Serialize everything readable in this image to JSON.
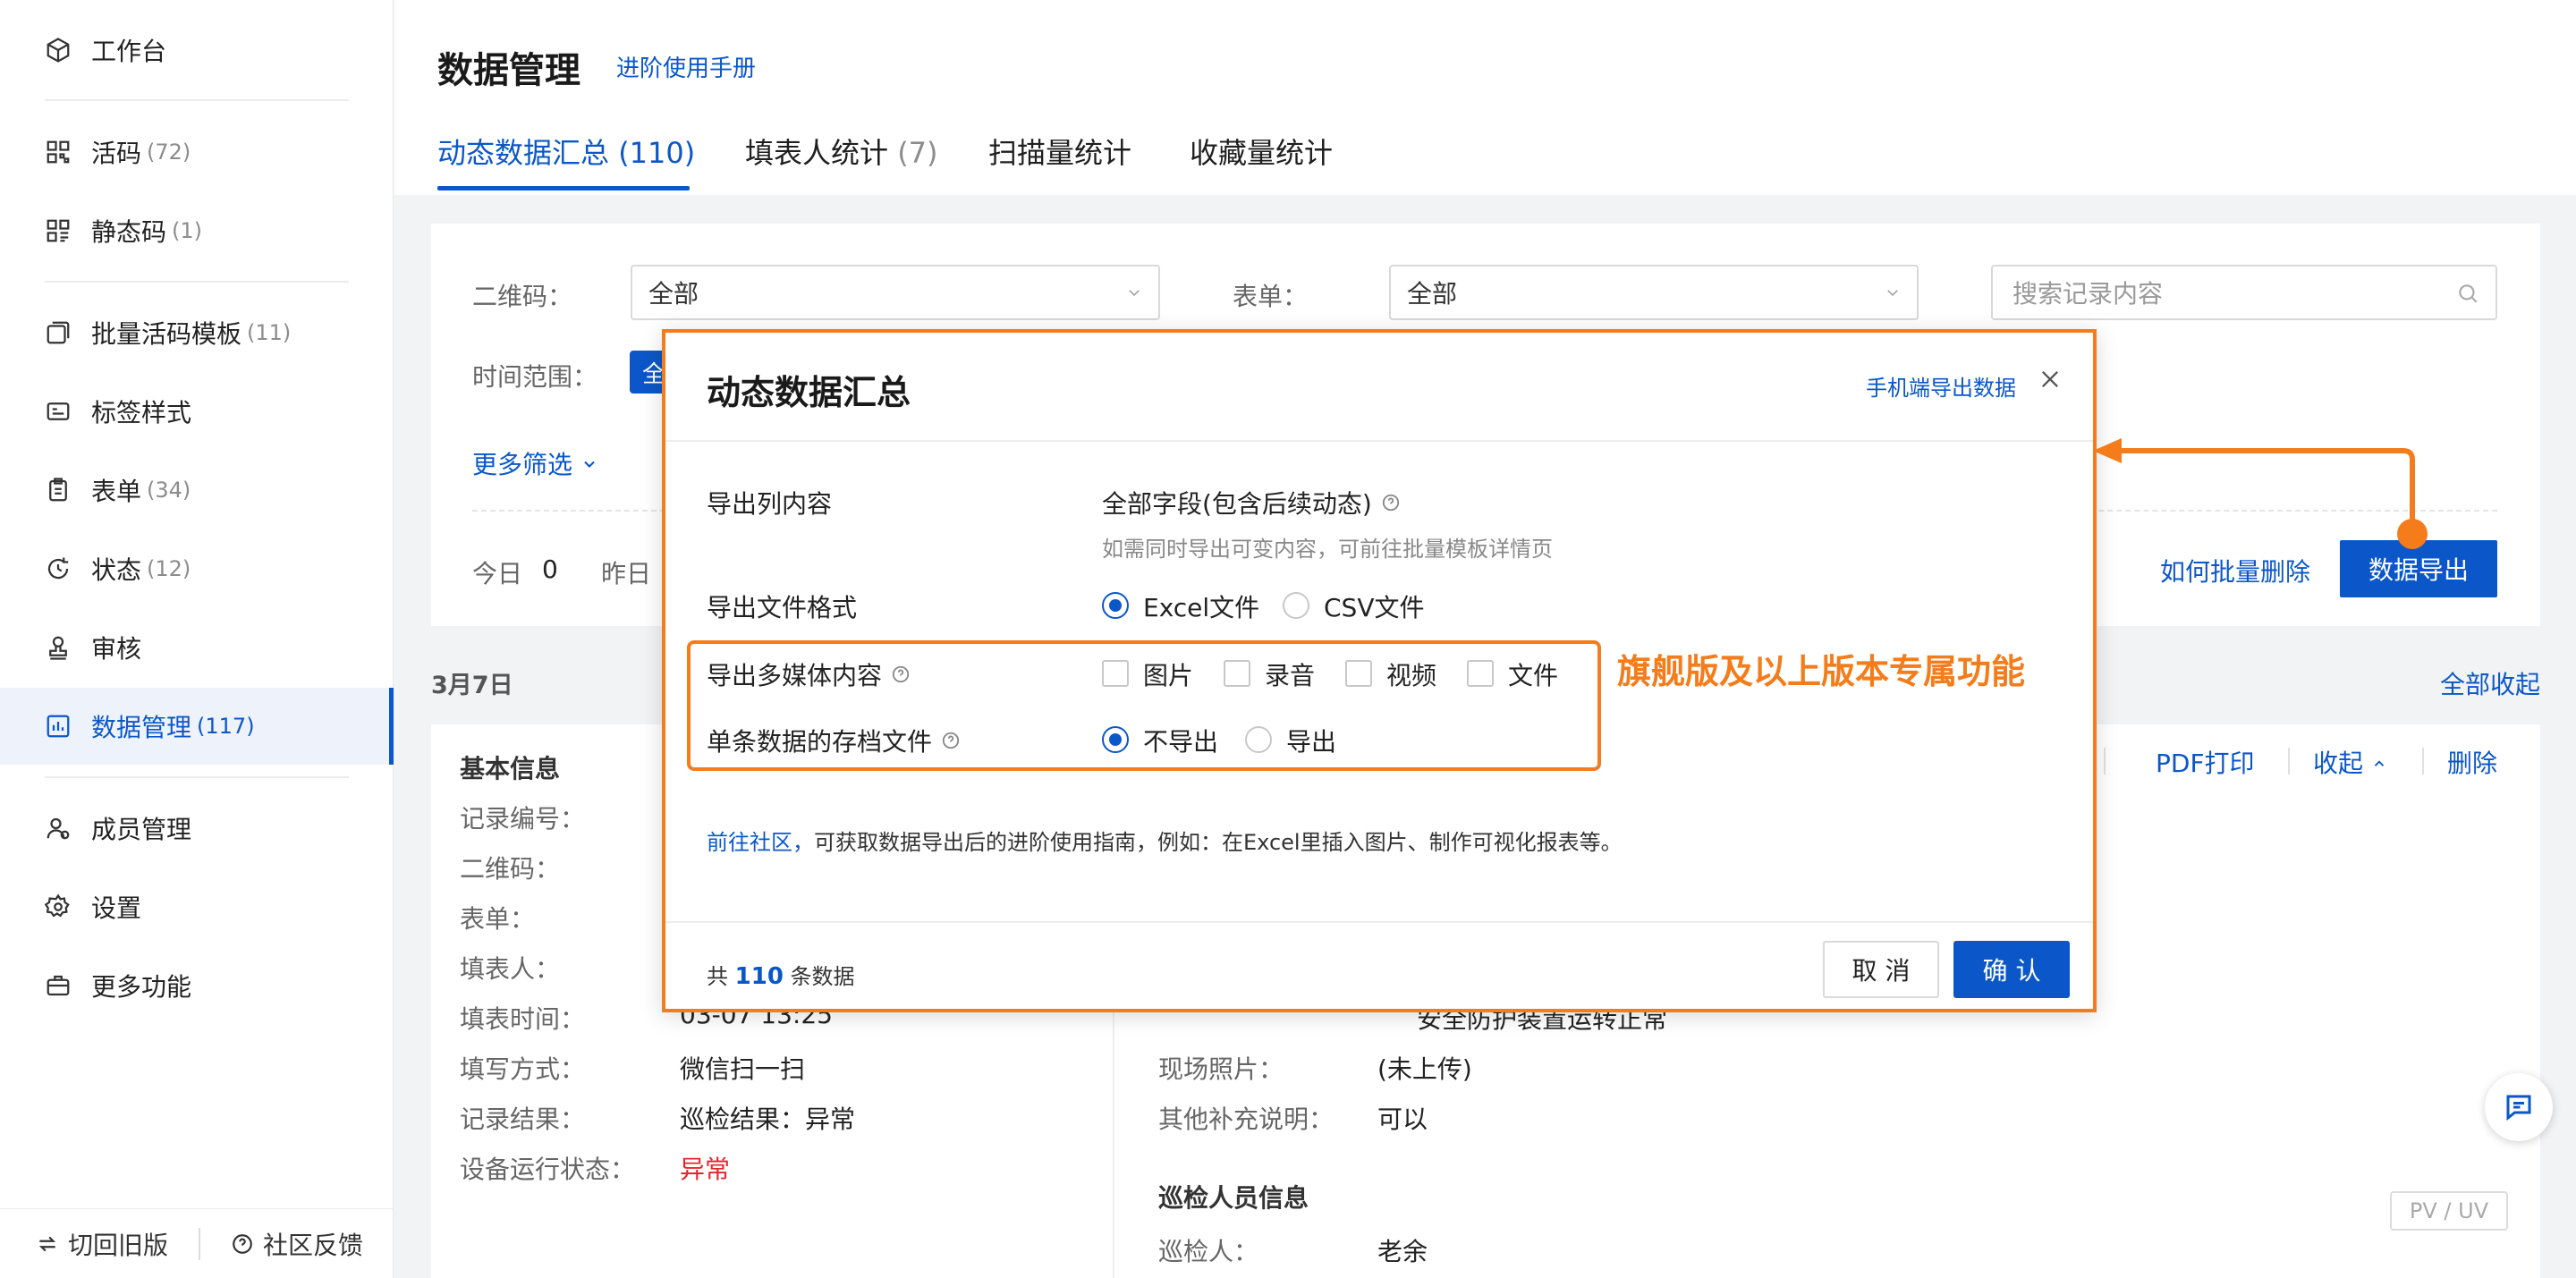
{
  "sidebar": {
    "items": [
      {
        "label": "工作台",
        "count": "",
        "icon": "cube-icon"
      },
      {
        "label": "活码",
        "count": "(72)",
        "icon": "qrcode-icon"
      },
      {
        "label": "静态码",
        "count": "(1)",
        "icon": "qrcode-static-icon"
      },
      {
        "label": "批量活码模板",
        "count": "(11)",
        "icon": "template-stack-icon"
      },
      {
        "label": "标签样式",
        "count": "",
        "icon": "label-card-icon"
      },
      {
        "label": "表单",
        "count": "(34)",
        "icon": "clipboard-icon"
      },
      {
        "label": "状态",
        "count": "(12)",
        "icon": "status-cycle-icon"
      },
      {
        "label": "审核",
        "count": "",
        "icon": "stamp-icon"
      },
      {
        "label": "数据管理",
        "count": "(117)",
        "icon": "bar-chart-icon"
      },
      {
        "label": "成员管理",
        "count": "",
        "icon": "member-icon"
      },
      {
        "label": "设置",
        "count": "",
        "icon": "gear-icon"
      },
      {
        "label": "更多功能",
        "count": "",
        "icon": "toolbox-icon"
      }
    ],
    "footer": {
      "switch_old": "切回旧版",
      "feedback": "社区反馈"
    }
  },
  "header": {
    "title": "数据管理",
    "manual_link": "进阶使用手册",
    "tabs": [
      {
        "label": "动态数据汇总",
        "count": "(110)"
      },
      {
        "label": "填表人统计",
        "count": "(7)"
      },
      {
        "label": "扫描量统计",
        "count": ""
      },
      {
        "label": "收藏量统计",
        "count": ""
      }
    ]
  },
  "filters": {
    "qrcode_label": "二维码：",
    "qrcode_value": "全部",
    "form_label": "表单：",
    "form_value": "全部",
    "search_placeholder": "搜索记录内容",
    "time_range_label": "时间范围：",
    "time_range_chip": "全",
    "more_filters": "更多筛选",
    "today_label": "今日",
    "today_value": "0",
    "yesterday_label": "昨日",
    "batch_delete_link": "如何批量删除",
    "export_button": "数据导出"
  },
  "records": {
    "date": "3月7日",
    "collapse_all": "全部收起",
    "actions": {
      "pdf_print": "PDF打印",
      "collapse": "收起",
      "delete": "删除"
    },
    "basic_title": "基本信息",
    "basic_fields": [
      {
        "key": "记录编号：",
        "value": ""
      },
      {
        "key": "二维码：",
        "value": ""
      },
      {
        "key": "表单：",
        "value": ""
      },
      {
        "key": "填表人：",
        "value": ""
      },
      {
        "key": "填表时间：",
        "value": "03-07 13:25"
      },
      {
        "key": "填写方式：",
        "value": "微信扫一扫"
      },
      {
        "key": "记录结果：",
        "value": "巡检结果：异常"
      },
      {
        "key": "设备运行状态：",
        "value": "异常"
      }
    ],
    "right_fields": [
      {
        "key": "",
        "value": "安全防护装置运转正常"
      },
      {
        "key": "现场照片：",
        "value": "(未上传)"
      },
      {
        "key": "其他补充说明：",
        "value": "可以"
      }
    ],
    "inspector_title": "巡检人员信息",
    "inspector_key": "巡检人：",
    "inspector_value": "老余",
    "pv_uv": "PV / UV"
  },
  "dialog": {
    "title": "动态数据汇总",
    "mobile_export_link": "手机端导出数据",
    "rows": {
      "columns_label": "导出列内容",
      "columns_value": "全部字段(包含后续动态)",
      "columns_hint": "如需同时导出可变内容，可前往批量模板详情页",
      "format_label": "导出文件格式",
      "format_options": [
        "Excel文件",
        "CSV文件"
      ],
      "format_selected": "Excel文件",
      "media_label": "导出多媒体内容",
      "media_options": [
        "图片",
        "录音",
        "视频",
        "文件"
      ],
      "archive_label": "单条数据的存档文件",
      "archive_options": [
        "不导出",
        "导出"
      ],
      "archive_selected": "不导出"
    },
    "flagship_note": "旗舰版及以上版本专属功能",
    "tip_link": "前往社区，",
    "tip_text": "可获取数据导出后的进阶使用指南，例如：在Excel里插入图片、制作可视化报表等。",
    "total_prefix": "共",
    "total_count": "110",
    "total_suffix": "条数据",
    "cancel": "取 消",
    "confirm": "确 认"
  },
  "colors": {
    "primary": "#0b57c9",
    "highlight": "#f47c1b",
    "danger": "#e4262b"
  }
}
